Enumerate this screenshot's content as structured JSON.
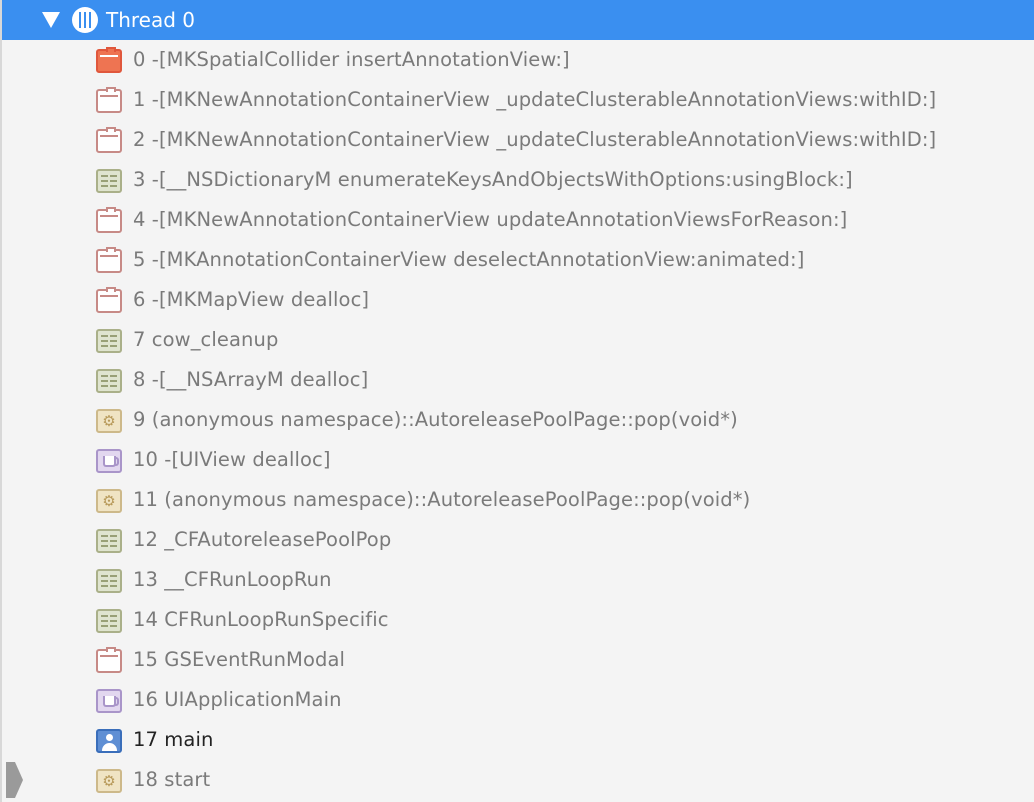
{
  "thread": {
    "title": "Thread 0",
    "icon": "thread-bars-icon",
    "accent_color": "#3a8ff0"
  },
  "frames": [
    {
      "label": "0 -[MKSpatialCollider insertAnnotationView:]",
      "icon": "briefcase-icon",
      "style": "hot"
    },
    {
      "label": "1 -[MKNewAnnotationContainerView _updateClusterableAnnotationViews:withID:]",
      "icon": "briefcase-icon"
    },
    {
      "label": "2 -[MKNewAnnotationContainerView _updateClusterableAnnotationViews:withID:]",
      "icon": "briefcase-icon"
    },
    {
      "label": "3 -[__NSDictionaryM enumerateKeysAndObjectsWithOptions:usingBlock:]",
      "icon": "table-icon"
    },
    {
      "label": "4 -[MKNewAnnotationContainerView updateAnnotationViewsForReason:]",
      "icon": "briefcase-icon"
    },
    {
      "label": "5 -[MKAnnotationContainerView deselectAnnotationView:animated:]",
      "icon": "briefcase-icon"
    },
    {
      "label": "6 -[MKMapView dealloc]",
      "icon": "briefcase-icon"
    },
    {
      "label": "7 cow_cleanup",
      "icon": "table-icon"
    },
    {
      "label": "8 -[__NSArrayM dealloc]",
      "icon": "table-icon"
    },
    {
      "label": "9 (anonymous namespace)::AutoreleasePoolPage::pop(void*)",
      "icon": "gear-icon"
    },
    {
      "label": "10 -[UIView dealloc]",
      "icon": "cup-icon"
    },
    {
      "label": "11 (anonymous namespace)::AutoreleasePoolPage::pop(void*)",
      "icon": "gear-icon"
    },
    {
      "label": "12 _CFAutoreleasePoolPop",
      "icon": "table-icon"
    },
    {
      "label": "13 __CFRunLoopRun",
      "icon": "table-icon"
    },
    {
      "label": "14 CFRunLoopRunSpecific",
      "icon": "table-icon"
    },
    {
      "label": "15 GSEventRunModal",
      "icon": "briefcase-icon"
    },
    {
      "label": "16 UIApplicationMain",
      "icon": "cup-icon"
    },
    {
      "label": "17 main",
      "icon": "person-icon",
      "style": "user"
    },
    {
      "label": "18 start",
      "icon": "gear-icon"
    }
  ]
}
